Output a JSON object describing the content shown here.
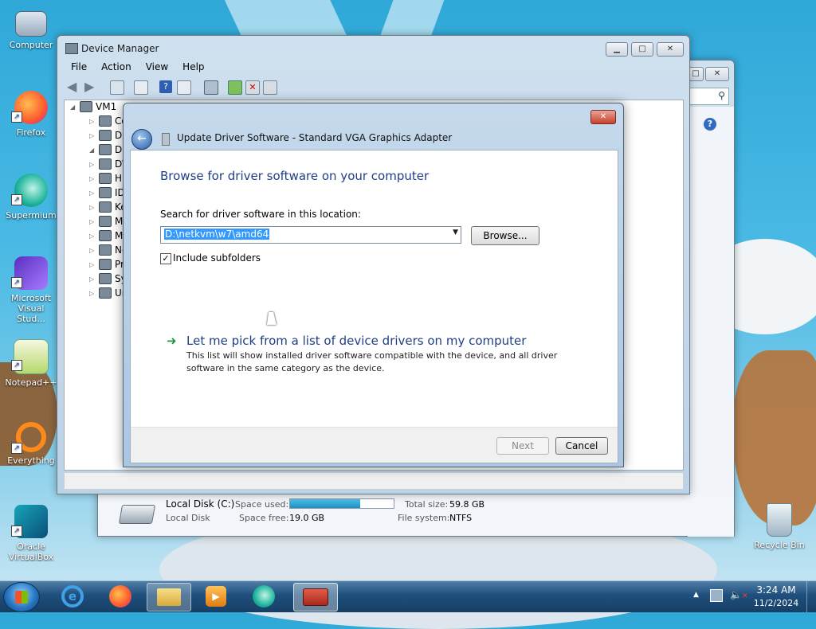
{
  "desktop": {
    "icons": [
      {
        "label": "Computer",
        "name": "computer-icon"
      },
      {
        "label": "Firefox",
        "name": "firefox-icon"
      },
      {
        "label": "Supermium",
        "name": "supermium-icon"
      },
      {
        "label": "Microsoft Visual Stud...",
        "name": "visual-studio-icon"
      },
      {
        "label": "Notepad++",
        "name": "notepad-plus-plus-icon"
      },
      {
        "label": "Everything",
        "name": "everything-icon"
      },
      {
        "label": "Oracle VirtualBox",
        "name": "virtualbox-icon"
      },
      {
        "label": "Recycle Bin",
        "name": "recycle-bin-icon"
      }
    ]
  },
  "device_manager": {
    "title": "Device Manager",
    "menu": [
      "File",
      "Action",
      "View",
      "Help"
    ],
    "tree": {
      "root": "VM1",
      "items": [
        "Co",
        "Di",
        "Di",
        "DV",
        "Hu",
        "ID",
        "Ke",
        "M",
        "M",
        "Ne",
        "Pr",
        "Sy",
        "Ur"
      ]
    }
  },
  "explorer_back": {
    "disk_name": "Local Disk (C:)",
    "disk_type": "Local Disk",
    "space_used_label": "Space used:",
    "space_free_label": "Space free:",
    "space_free_value": "19.0 GB",
    "total_size_label": "Total size:",
    "total_size_value": "59.8 GB",
    "file_system_label": "File system:",
    "file_system_value": "NTFS",
    "used_fraction": 0.68
  },
  "dialog": {
    "title": "Update Driver Software - Standard VGA Graphics Adapter",
    "heading": "Browse for driver software on your computer",
    "search_label": "Search for driver software in this location:",
    "path_value": "D:\\netkvm\\w7\\amd64",
    "browse_label": "Browse...",
    "include_subfolders_label": "Include subfolders",
    "include_subfolders_checked": true,
    "pick_title": "Let me pick from a list of device drivers on my computer",
    "pick_desc_line1": "This list will show installed driver software compatible with the device, and all driver",
    "pick_desc_line2": "software in the same category as the device.",
    "next_label": "Next",
    "cancel_label": "Cancel"
  },
  "taskbar": {
    "time": "3:24 AM",
    "date": "11/2/2024"
  },
  "colors": {
    "heading_blue": "#1e3f86",
    "link_green": "#1e9a3a",
    "selection_blue": "#3399ff",
    "progress_fill": "#26a0da"
  }
}
